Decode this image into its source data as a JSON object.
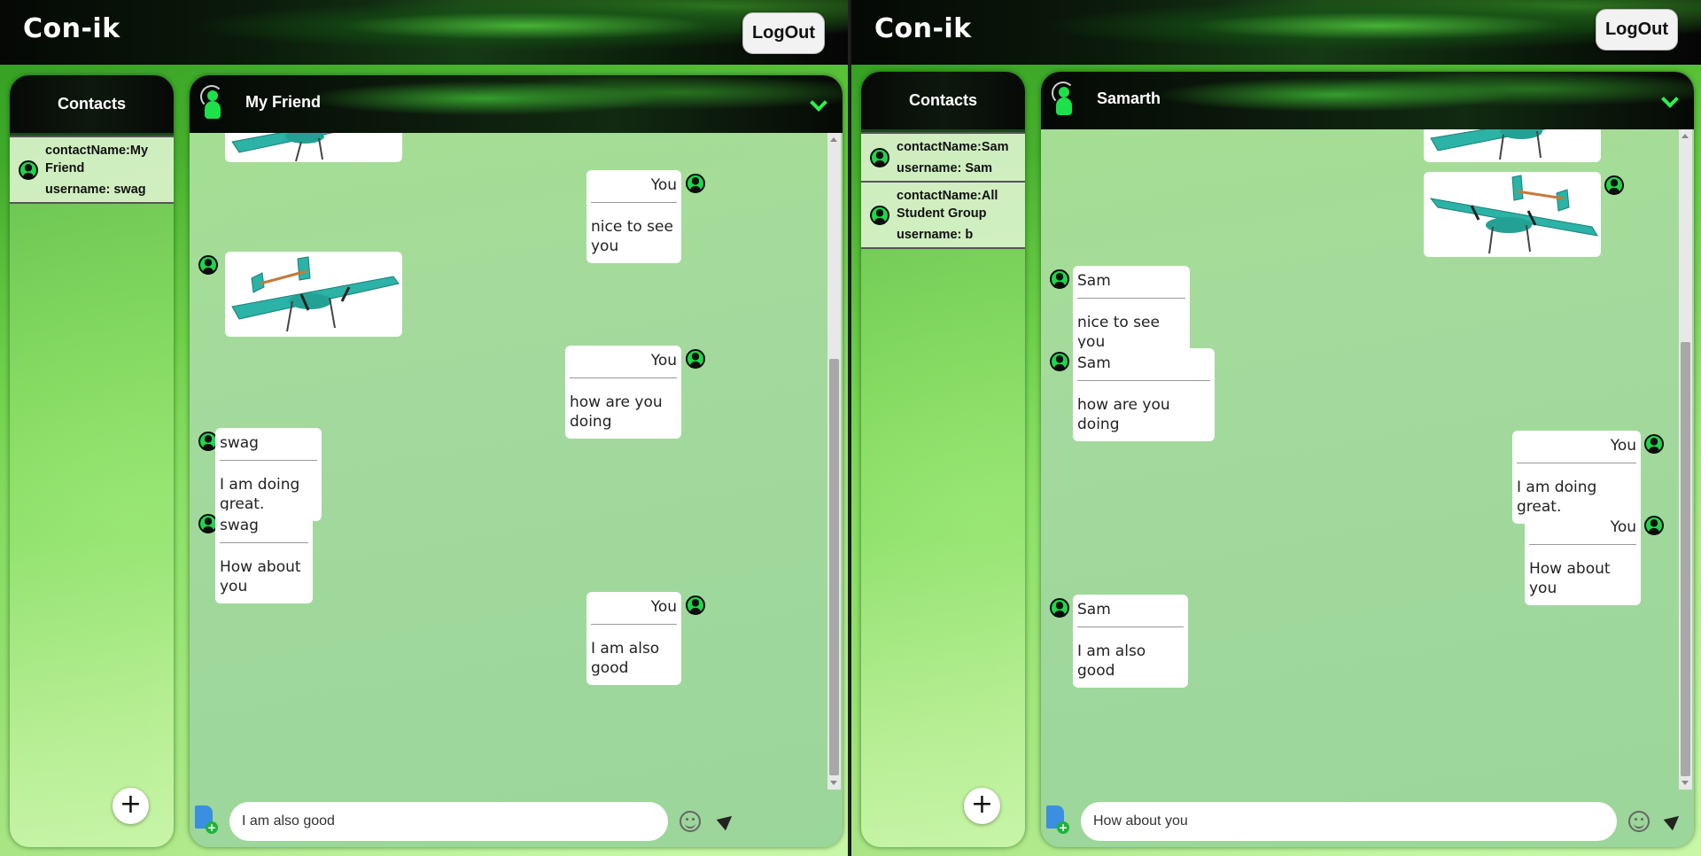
{
  "panes": [
    {
      "app_title": "Con-ik",
      "logout_label": "LogOut",
      "contacts_header": "Contacts",
      "contacts": [
        {
          "name": "contactName:My Friend",
          "username": "username: swag"
        }
      ],
      "chat_title": "My Friend",
      "input_value": "I am also good",
      "messages": [
        {
          "type": "image",
          "mine": false,
          "image": "drone"
        },
        {
          "type": "text",
          "mine": true,
          "sender": "You",
          "text": "nice to see you"
        },
        {
          "type": "image",
          "mine": false,
          "image": "drone"
        },
        {
          "type": "text",
          "mine": true,
          "sender": "You",
          "text": "how are you doing"
        },
        {
          "type": "text",
          "mine": false,
          "sender": "swag",
          "text": "I am doing great."
        },
        {
          "type": "text",
          "mine": false,
          "sender": "swag",
          "text": "How about you"
        },
        {
          "type": "text",
          "mine": true,
          "sender": "You",
          "text": "I am also good"
        }
      ]
    },
    {
      "app_title": "Con-ik",
      "logout_label": "LogOut",
      "contacts_header": "Contacts",
      "contacts": [
        {
          "name": "contactName:Sam",
          "username": "username: Sam"
        },
        {
          "name": "contactName:All Student Group",
          "username": "username: b"
        }
      ],
      "chat_title": "Samarth",
      "input_value": "How about you",
      "messages": [
        {
          "type": "image",
          "mine": true,
          "image": "drone"
        },
        {
          "type": "image",
          "mine": true,
          "image": "drone"
        },
        {
          "type": "text",
          "mine": false,
          "sender": "Sam",
          "text": "nice to see you"
        },
        {
          "type": "text",
          "mine": false,
          "sender": "Sam",
          "text": "how are you doing"
        },
        {
          "type": "text",
          "mine": true,
          "sender": "You",
          "text": "I am doing great."
        },
        {
          "type": "text",
          "mine": true,
          "sender": "You",
          "text": "How about you"
        },
        {
          "type": "text",
          "mine": false,
          "sender": "Sam",
          "text": "I am also good"
        }
      ]
    }
  ],
  "colors": {
    "accent": "#2ef04a",
    "avatar": "#1fd64a"
  },
  "icons": [
    "chevron-down-icon",
    "file-attach-icon",
    "emoji-icon",
    "send-icon",
    "add-icon",
    "user-avatar-icon"
  ]
}
